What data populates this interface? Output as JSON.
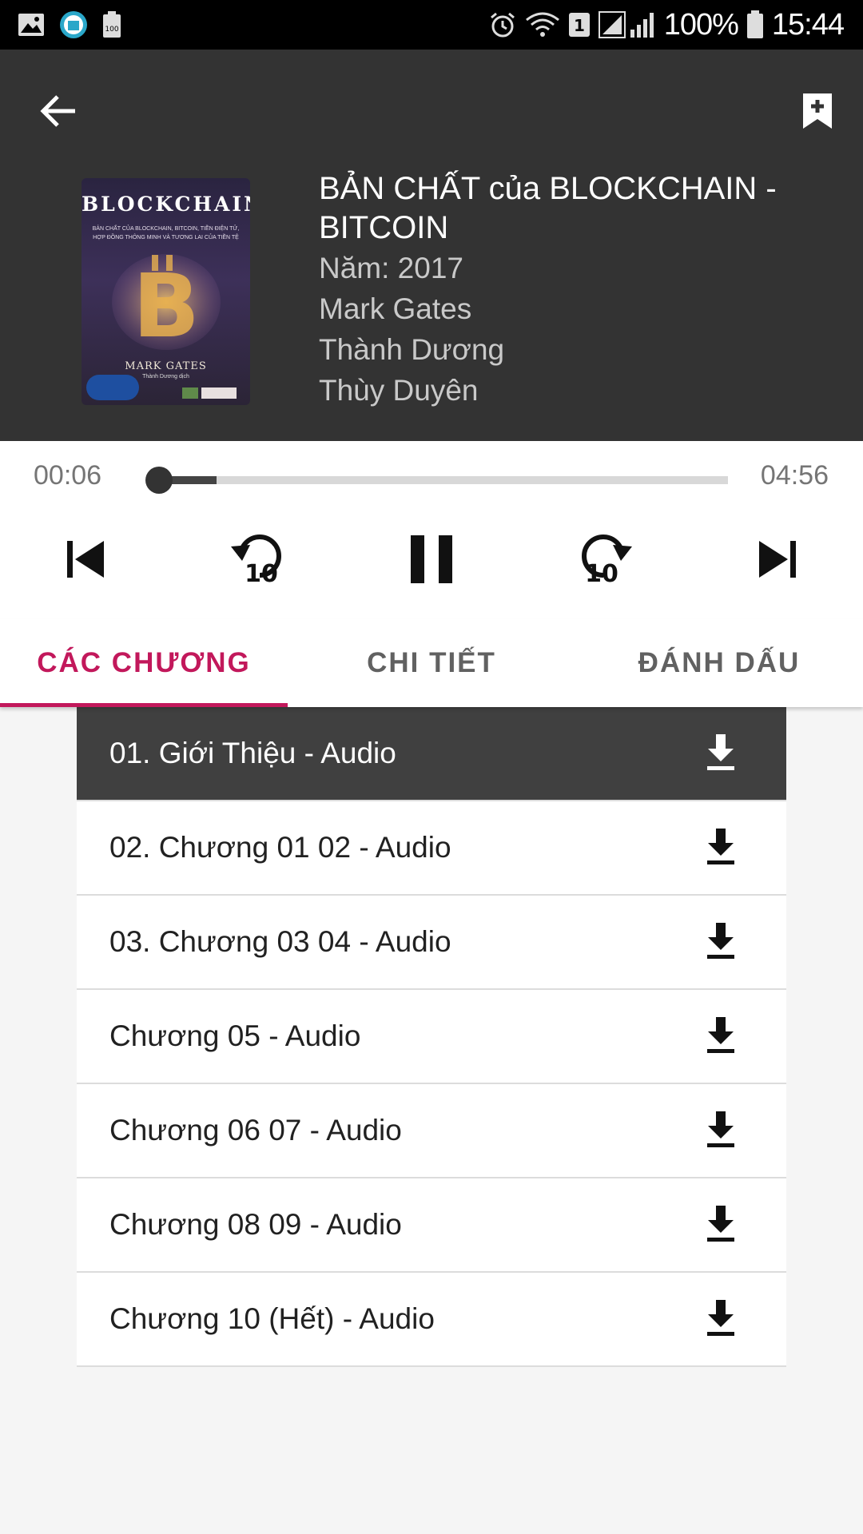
{
  "status_bar": {
    "battery_percent": "100%",
    "time": "15:44",
    "icons": [
      "gallery-icon",
      "app-icon",
      "battery-saver-icon",
      "alarm-icon",
      "wifi-icon",
      "sim-1-icon",
      "signal-icon",
      "battery-icon"
    ]
  },
  "header": {
    "icons": {
      "back": "arrow-back-icon",
      "bookmark": "bookmark-add-icon"
    },
    "cover": {
      "title": "BLOCKCHAIN",
      "subtitle": "BẢN CHẤT CỦA BLOCKCHAIN, BITCOIN, TIỀN ĐIỆN TỬ, HỢP ĐỒNG THÔNG MINH VÀ TƯƠNG LAI CỦA TIỀN TỆ",
      "author": "MARK GATES",
      "translator": "Thành Dương dịch"
    },
    "book": {
      "title": "BẢN CHẤT của BLOCKCHAIN - BITCOIN",
      "year": "Năm: 2017",
      "author": "Mark Gates",
      "translator": "Thành Dương",
      "narrator": "Thùy Duyên"
    }
  },
  "player": {
    "current_time": "00:06",
    "total_time": "04:56",
    "progress_fraction": 0.02,
    "buffered_fraction": 0.12,
    "controls": [
      "skip-previous-icon",
      "replay-10-icon",
      "pause-icon",
      "forward-10-icon",
      "skip-next-icon"
    ]
  },
  "tabs": [
    {
      "label": "CÁC CHƯƠNG",
      "active": true
    },
    {
      "label": "CHI TIẾT",
      "active": false
    },
    {
      "label": "ĐÁNH DẤU",
      "active": false
    }
  ],
  "chapters": [
    {
      "label": "01. Giới Thiệu - Audio",
      "active": true
    },
    {
      "label": "02. Chương 01 02 - Audio",
      "active": false
    },
    {
      "label": "03. Chương 03 04 - Audio",
      "active": false
    },
    {
      "label": "Chương 05 - Audio",
      "active": false
    },
    {
      "label": "Chương 06 07 - Audio",
      "active": false
    },
    {
      "label": "Chương 08 09 - Audio",
      "active": false
    },
    {
      "label": "Chương 10 (Hết) - Audio",
      "active": false
    }
  ],
  "colors": {
    "header_bg": "#333333",
    "accent": "#c2185b",
    "active_row_bg": "#404040"
  }
}
